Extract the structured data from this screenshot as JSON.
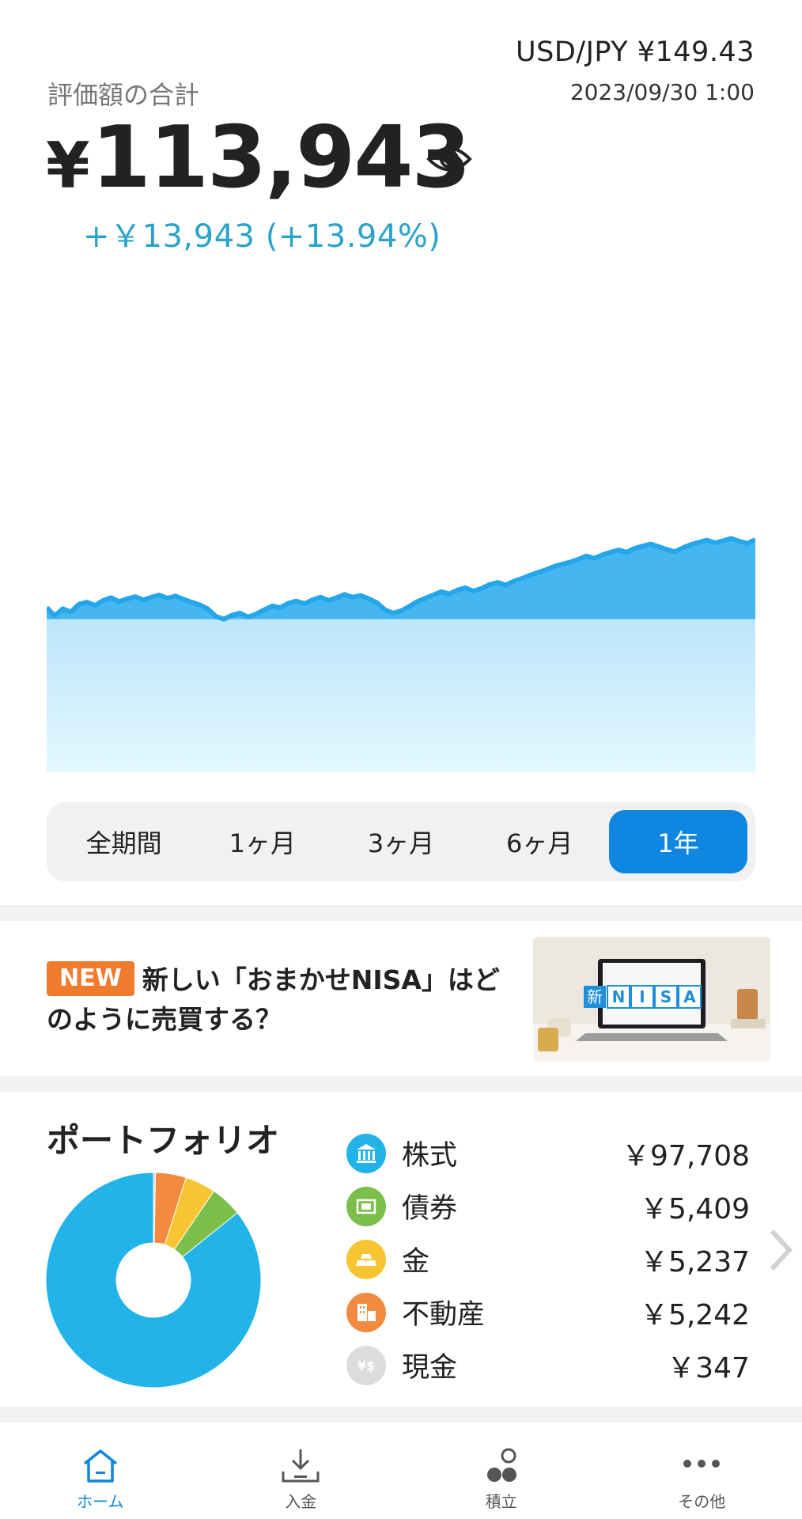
{
  "header": {
    "fx_rate": "USD/JPY ¥149.43",
    "fx_time": "2023/09/30 1:00",
    "total_label": "評価額の合計",
    "total_currency": "¥",
    "total_value": "113,943",
    "gain": "+￥13,943 (+13.94%)"
  },
  "chart_data": {
    "type": "area",
    "x": [
      "1年"
    ],
    "series": [
      {
        "values": [
          100.0,
          98.5,
          99.8,
          99.2,
          100.6,
          101.0,
          100.4,
          101.3,
          101.8,
          101.1,
          101.6,
          102.0,
          101.4,
          101.9,
          102.3,
          101.7,
          102.1,
          101.5,
          101.0,
          100.5,
          99.8,
          98.4,
          97.9,
          98.6,
          99.0,
          98.3,
          98.8,
          99.6,
          100.3,
          100.0,
          100.8,
          101.2,
          100.7,
          101.4,
          101.9,
          101.3,
          101.8,
          102.4,
          101.9,
          102.2,
          101.6,
          100.9,
          99.6,
          99.0,
          99.4,
          100.2,
          101.1,
          101.7,
          102.3,
          102.9,
          102.5,
          103.2,
          103.6,
          103.0,
          103.5,
          104.2,
          104.6,
          104.1,
          104.8,
          105.3,
          105.9,
          106.4,
          106.9,
          107.5,
          107.9,
          108.3,
          108.8,
          109.4,
          109.0,
          109.6,
          110.1,
          110.5,
          110.1,
          110.8,
          111.2,
          111.6,
          111.1,
          110.6,
          110.2,
          110.9,
          111.5,
          111.9,
          112.3,
          111.8,
          112.2,
          112.6,
          112.1,
          111.7,
          112.4
        ]
      }
    ]
  },
  "periods": {
    "all": "全期間",
    "m1": "1ヶ月",
    "m3": "3ヶ月",
    "m6": "6ヶ月",
    "y1": "1年"
  },
  "news": {
    "badge": "NEW",
    "text": "新しい「おまかせNISA」はどのように売買する？",
    "thumb_kanji": "新",
    "thumb_letters": [
      "N",
      "I",
      "S",
      "A"
    ]
  },
  "portfolio": {
    "title": "ポートフォリオ",
    "assets": [
      {
        "name": "株式",
        "value": "￥97,708",
        "color": "#22b3e8",
        "icon": "bank-icon",
        "amount": 97708
      },
      {
        "name": "債券",
        "value": "￥5,409",
        "color": "#7bbf4a",
        "icon": "bond-icon",
        "amount": 5409
      },
      {
        "name": "金",
        "value": "￥5,237",
        "color": "#f7c531",
        "icon": "gold-icon",
        "amount": 5237
      },
      {
        "name": "不動産",
        "value": "￥5,242",
        "color": "#f28a3f",
        "icon": "building-icon",
        "amount": 5242
      },
      {
        "name": "現金",
        "value": "￥347",
        "color": "#d7d7d9",
        "icon": "cash-icon",
        "amount": 347
      }
    ]
  },
  "nav": {
    "home": "ホーム",
    "deposit": "入金",
    "savings": "積立",
    "more": "その他"
  },
  "colors": {
    "accent": "#0f86e0",
    "gain": "#2aa3c9",
    "chart_line": "#24a6ea",
    "badge": "#f07a2e"
  }
}
